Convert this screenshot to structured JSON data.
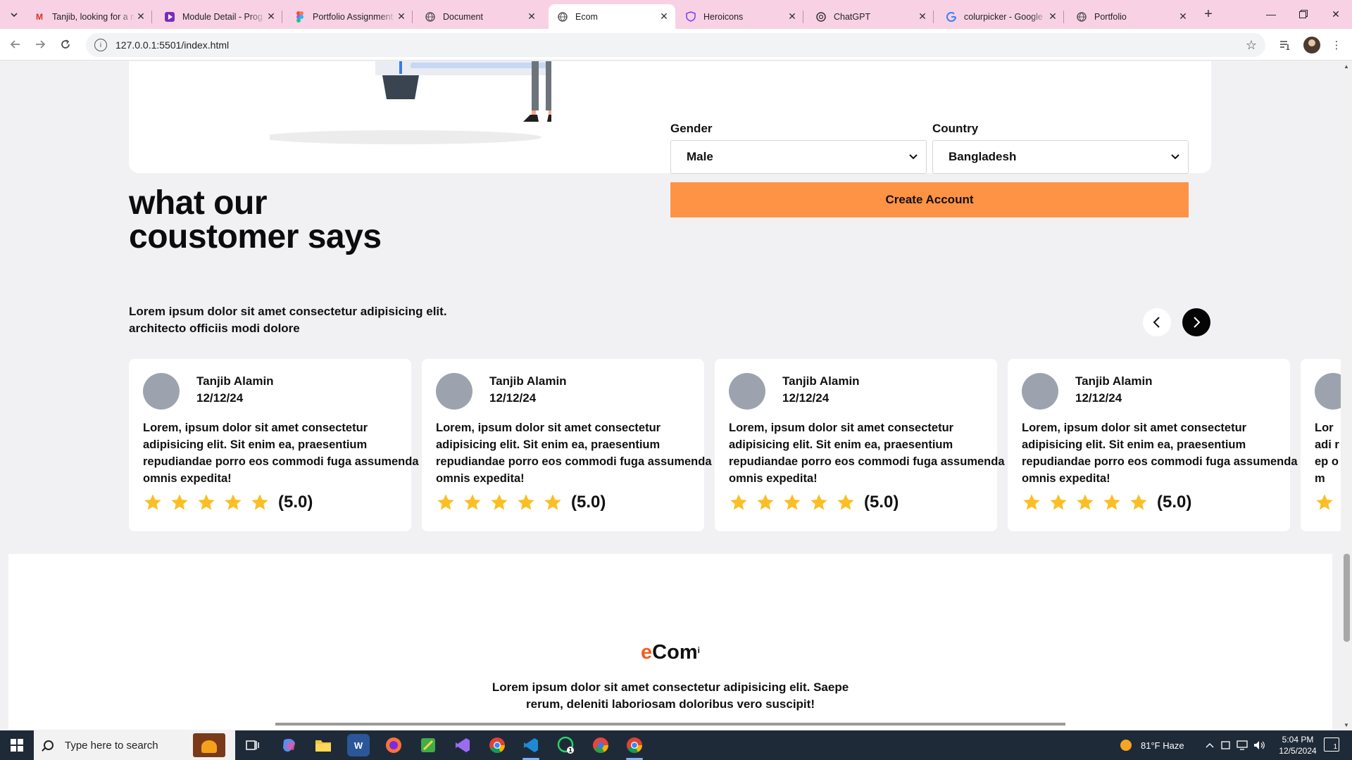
{
  "browser": {
    "tabs": [
      {
        "title": "Tanjib, looking for a n",
        "icon": "gmail-icon",
        "color": "#d93025"
      },
      {
        "title": "Module Detail - Prog",
        "icon": "play-icon",
        "color": "#7b2cbf"
      },
      {
        "title": "Portfolio Assignment",
        "icon": "figma-icon",
        "color": "#f24e1e"
      },
      {
        "title": "Document",
        "icon": "globe-icon",
        "color": "#555555"
      },
      {
        "title": "Ecom",
        "icon": "globe-icon",
        "color": "#555555",
        "active": true
      },
      {
        "title": "Heroicons",
        "icon": "shield-icon",
        "color": "#7c3aed"
      },
      {
        "title": "ChatGPT",
        "icon": "chatgpt-icon",
        "color": "#333333"
      },
      {
        "title": "colurpicker - Google",
        "icon": "google-icon",
        "color": "#4285f4"
      },
      {
        "title": "Portfolio",
        "icon": "globe-icon",
        "color": "#555555"
      }
    ],
    "url": "127.0.0.1:5501/index.html"
  },
  "form": {
    "gender_label": "Gender",
    "gender_value": "Male",
    "country_label": "Country",
    "country_value": "Bangladesh",
    "create_button": "Create Account",
    "accent_color": "#fe9245"
  },
  "testimonials": {
    "heading": "what our coustomer says",
    "subtitle": "Lorem ipsum dolor sit amet consectetur adipisicing elit. architecto officiis modi dolore",
    "cards": [
      {
        "name": "Tanjib Alamin",
        "date": "12/12/24",
        "text": "Lorem, ipsum dolor sit amet consectetur adipisicing elit. Sit enim ea, praesentium repudiandae porro eos commodi fuga assumenda omnis expedita!",
        "rating": "(5.0)",
        "stars": 5
      },
      {
        "name": "Tanjib Alamin",
        "date": "12/12/24",
        "text": "Lorem, ipsum dolor sit amet consectetur adipisicing elit. Sit enim ea, praesentium repudiandae porro eos commodi fuga assumenda omnis expedita!",
        "rating": "(5.0)",
        "stars": 5
      },
      {
        "name": "Tanjib Alamin",
        "date": "12/12/24",
        "text": "Lorem, ipsum dolor sit amet consectetur adipisicing elit. Sit enim ea, praesentium repudiandae porro eos commodi fuga assumenda omnis expedita!",
        "rating": "(5.0)",
        "stars": 5
      },
      {
        "name": "Tanjib Alamin",
        "date": "12/12/24",
        "text": "Lorem, ipsum dolor sit amet consectetur adipisicing elit. Sit enim ea, praesentium repudiandae porro eos commodi fuga assumenda omnis expedita!",
        "rating": "(5.0)",
        "stars": 5
      },
      {
        "name": "",
        "date": "",
        "text": "Lor adi rep om",
        "rating": "",
        "stars": 1
      }
    ],
    "star_color": "#fbbf24"
  },
  "footer": {
    "brand_accent": "e",
    "brand_rest": "Com",
    "brand_dot": "i",
    "text": "Lorem ipsum dolor sit amet consectetur adipisicing elit. Saepe rerum, deleniti laboriosam doloribus vero suscipit!"
  },
  "taskbar": {
    "search_placeholder": "Type here to search",
    "weather": "81°F  Haze",
    "time": "5:04 PM",
    "date": "12/5/2024",
    "notifications": "1"
  }
}
